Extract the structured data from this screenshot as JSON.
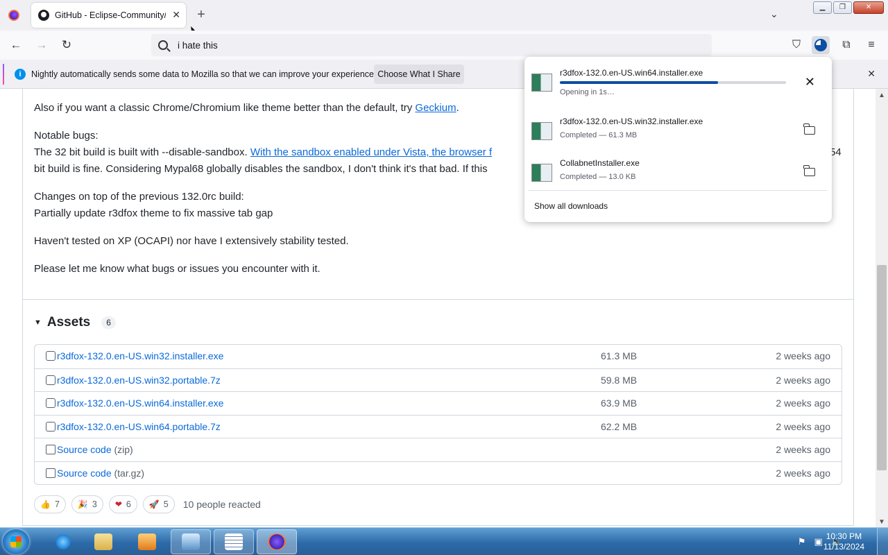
{
  "browser": {
    "tab_title": "GitHub - Eclipse-Community/r",
    "url_text": "i hate this",
    "notification": {
      "message": "Nightly automatically sends some data to Mozilla so that we can improve your experience.",
      "button": "Choose What I Share"
    }
  },
  "content": {
    "para1_text": "Also if you want a classic Chrome/Chromium like theme better than the default, try ",
    "para1_link": "Geckium",
    "para1_end": ".",
    "bugs_title": "Notable bugs:",
    "bugs_line1_text": "The 32 bit build is built with --disable-sandbox. ",
    "bugs_line1_link": "With the sandbox enabled under Vista, the browser f",
    "bugs_line1_tail": "54",
    "bugs_line2": "bit build is fine. Considering Mypal68 globally disables the sandbox, I don't think it's that bad. If this",
    "changes_title": "Changes on top of the previous 132.0rc build:",
    "changes_line": "Partially update r3dfox theme to fix massive tab gap",
    "xp_note": "Haven't tested on XP (OCAPI) nor have I extensively stability tested.",
    "feedback": "Please let me know what bugs or issues you encounter with it."
  },
  "assets": {
    "title": "Assets",
    "count": "6",
    "items": [
      {
        "name": "r3dfox-132.0.en-US.win32.installer.exe",
        "suffix": "",
        "size": "61.3 MB",
        "date": "2 weeks ago"
      },
      {
        "name": "r3dfox-132.0.en-US.win32.portable.7z",
        "suffix": "",
        "size": "59.8 MB",
        "date": "2 weeks ago"
      },
      {
        "name": "r3dfox-132.0.en-US.win64.installer.exe",
        "suffix": "",
        "size": "63.9 MB",
        "date": "2 weeks ago"
      },
      {
        "name": "r3dfox-132.0.en-US.win64.portable.7z",
        "suffix": "",
        "size": "62.2 MB",
        "date": "2 weeks ago"
      },
      {
        "name": "Source code",
        "suffix": " (zip)",
        "size": "",
        "date": "2 weeks ago"
      },
      {
        "name": "Source code",
        "suffix": " (tar.gz)",
        "size": "",
        "date": "2 weeks ago"
      }
    ]
  },
  "reactions": {
    "items": [
      {
        "emoji": "👍",
        "count": "7"
      },
      {
        "emoji": "🎉",
        "count": "3"
      },
      {
        "emoji": "❤",
        "count": "6"
      },
      {
        "emoji": "🚀",
        "count": "5"
      }
    ],
    "summary": "10 people reacted"
  },
  "downloads": {
    "items": [
      {
        "file": "r3dfox-132.0.en-US.win64.installer.exe",
        "status": "Opening in 1s…",
        "progress": 0.7
      },
      {
        "file": "r3dfox-132.0.en-US.win32.installer.exe",
        "status": "Completed — 61.3 MB"
      },
      {
        "file": "CollabnetInstaller.exe",
        "status": "Completed — 13.0 KB"
      }
    ],
    "show_all": "Show all downloads"
  },
  "taskbar": {
    "time": "10:30 PM",
    "date": "11/13/2024"
  }
}
